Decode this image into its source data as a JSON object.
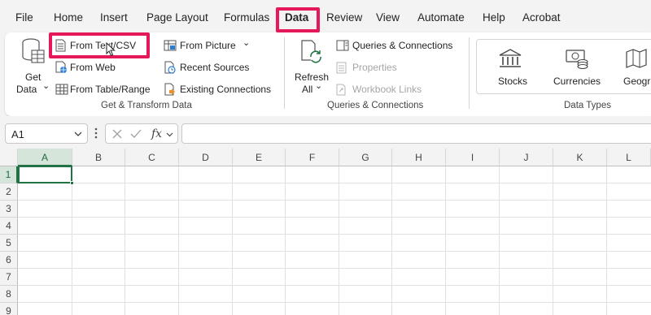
{
  "menu": {
    "tabs": [
      "File",
      "Home",
      "Insert",
      "Page Layout",
      "Formulas",
      "Data",
      "Review",
      "View",
      "Automate",
      "Help",
      "Acrobat"
    ],
    "active": "Data"
  },
  "ribbon": {
    "get_transform": {
      "get_data_line1": "Get",
      "get_data_line2": "Data",
      "get_data_chevron": "⌄",
      "from_text_csv": "From Text/CSV",
      "from_web": "From Web",
      "from_table_range": "From Table/Range",
      "from_picture": "From Picture",
      "from_picture_chevron": "⌄",
      "recent_sources": "Recent Sources",
      "existing_connections": "Existing Connections",
      "group_label": "Get & Transform Data"
    },
    "queries": {
      "refresh_line1": "Refresh",
      "refresh_line2": "All",
      "refresh_chevron": "⌄",
      "queries_connections": "Queries & Connections",
      "properties": "Properties",
      "workbook_links": "Workbook Links",
      "group_label": "Queries & Connections"
    },
    "data_types": {
      "stocks": "Stocks",
      "currencies": "Currencies",
      "geography": "Geograp",
      "group_label": "Data Types"
    }
  },
  "formula_bar": {
    "name_box": "A1",
    "fx": "fx",
    "formula": ""
  },
  "grid": {
    "columns": [
      "A",
      "B",
      "C",
      "D",
      "E",
      "F",
      "G",
      "H",
      "I",
      "J",
      "K",
      "L"
    ],
    "rows": [
      "1",
      "2",
      "3",
      "4",
      "5",
      "6",
      "7",
      "8",
      "9"
    ],
    "selected_cell": "A1"
  },
  "colors": {
    "highlight": "#e5195a",
    "excel_green": "#217346"
  }
}
